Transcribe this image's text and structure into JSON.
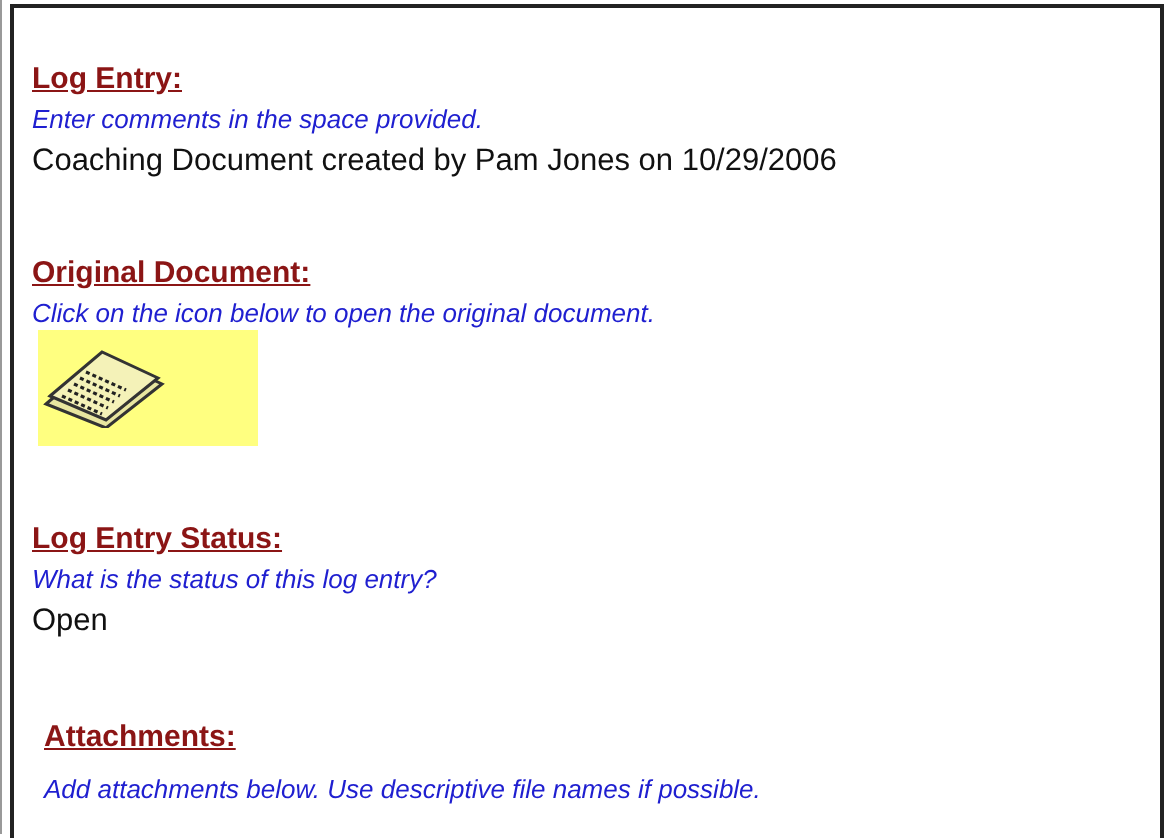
{
  "sections": [
    {
      "kind": "text",
      "title": "Log Entry:",
      "hint": "Enter comments in the space provided.",
      "value": "Coaching Document created by Pam Jones on 10/29/2006"
    },
    {
      "kind": "document",
      "title": "Original Document:",
      "hint": "Click on the icon below to open the original document."
    },
    {
      "kind": "text",
      "title": "Log Entry Status:",
      "hint": "What is the status of this log entry?",
      "value": "Open"
    },
    {
      "kind": "attachments",
      "title": "Attachments:",
      "hint": "Add attachments below. Use descriptive file names if possible."
    }
  ]
}
